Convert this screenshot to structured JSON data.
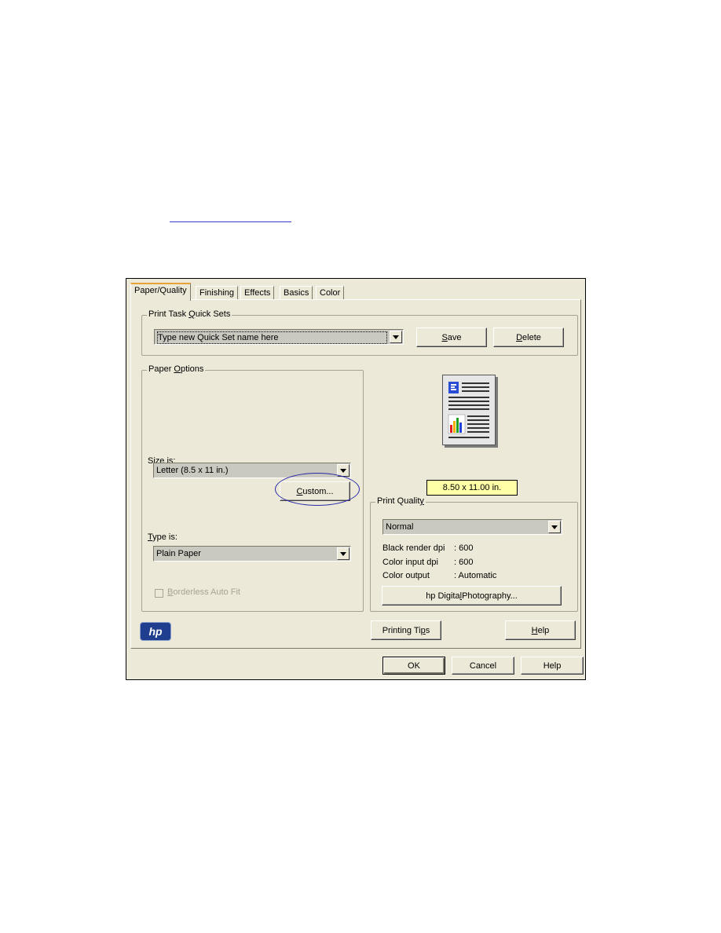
{
  "tabs": [
    "Paper/Quality",
    "Finishing",
    "Effects",
    "Basics",
    "Color"
  ],
  "quick_sets": {
    "title": "Print Task Quick Sets",
    "value": "Type new Quick Set name here",
    "save": "Save",
    "delete": "Delete"
  },
  "paper_options": {
    "title": "Paper Options",
    "size_label": "Size is:",
    "size_value": "Letter (8.5 x 11 in.)",
    "custom_button": "Custom...",
    "type_label": "Type is:",
    "type_value": "Plain Paper",
    "borderless_label": "Borderless Auto Fit"
  },
  "preview": {
    "size_text": "8.50 x 11.00 in."
  },
  "print_quality": {
    "title": "Print Quality",
    "value": "Normal",
    "rows": [
      {
        "label": "Black render dpi",
        "value": ": 600"
      },
      {
        "label": "Color input dpi",
        "value": ": 600"
      },
      {
        "label": "Color output",
        "value": ": Automatic"
      }
    ],
    "photo_button": "hp Digital Photography..."
  },
  "footer": {
    "logo": "hp",
    "tips_button": "Printing Tips",
    "help_button": "Help",
    "ok": "OK",
    "cancel": "Cancel",
    "help": "Help"
  }
}
